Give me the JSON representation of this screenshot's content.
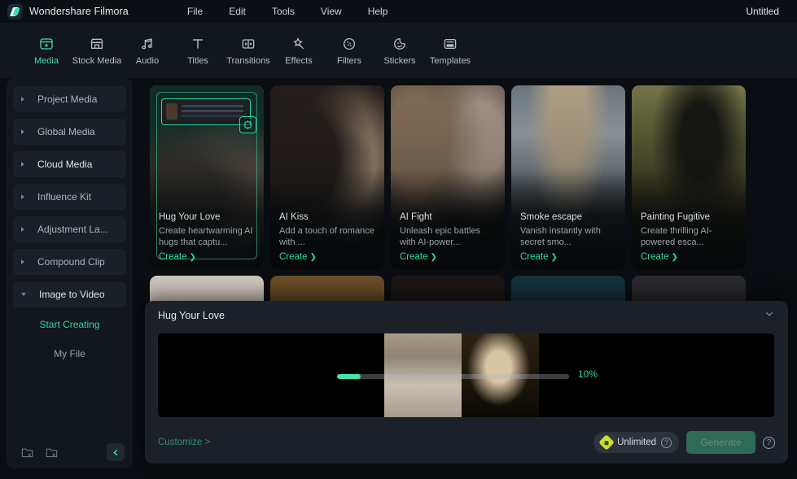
{
  "titlebar": {
    "app_name": "Wondershare Filmora",
    "project_name": "Untitled",
    "menus": [
      "File",
      "Edit",
      "Tools",
      "View",
      "Help"
    ]
  },
  "toolbar": {
    "items": [
      {
        "label": "Media",
        "icon": "media-icon",
        "active": true
      },
      {
        "label": "Stock Media",
        "icon": "stock-media-icon",
        "active": false
      },
      {
        "label": "Audio",
        "icon": "audio-icon",
        "active": false
      },
      {
        "label": "Titles",
        "icon": "titles-icon",
        "active": false
      },
      {
        "label": "Transitions",
        "icon": "transitions-icon",
        "active": false
      },
      {
        "label": "Effects",
        "icon": "effects-icon",
        "active": false
      },
      {
        "label": "Filters",
        "icon": "filters-icon",
        "active": false
      },
      {
        "label": "Stickers",
        "icon": "stickers-icon",
        "active": false
      },
      {
        "label": "Templates",
        "icon": "templates-icon",
        "active": false
      }
    ]
  },
  "sidebar": {
    "items": [
      {
        "label": "Project Media",
        "expanded": false
      },
      {
        "label": "Global Media",
        "expanded": false
      },
      {
        "label": "Cloud Media",
        "expanded": false
      },
      {
        "label": "Influence Kit",
        "expanded": false
      },
      {
        "label": "Adjustment La...",
        "expanded": false
      },
      {
        "label": "Compound Clip",
        "expanded": false
      },
      {
        "label": "Image to Video",
        "expanded": true
      }
    ],
    "sub_items": [
      {
        "label": "Start Creating",
        "active": true
      },
      {
        "label": "My File",
        "active": false
      }
    ],
    "footer": {
      "add_folder_icon": "folder-add-icon",
      "delete_folder_icon": "folder-delete-icon",
      "collapse_icon": "chevron-left-icon"
    }
  },
  "cards": [
    {
      "title": "Hug Your Love",
      "desc": "Create heartwarming AI hugs that captu...",
      "cta": "Create",
      "selected": true
    },
    {
      "title": "AI Kiss",
      "desc": "Add a touch of romance with ...",
      "cta": "Create",
      "selected": false
    },
    {
      "title": "AI Fight",
      "desc": "Unleash epic battles with AI-power...",
      "cta": "Create",
      "selected": false
    },
    {
      "title": "Smoke escape",
      "desc": "Vanish instantly with secret smo...",
      "cta": "Create",
      "selected": false
    },
    {
      "title": "Painting Fugitive",
      "desc": "Create thrilling AI-powered esca...",
      "cta": "Create",
      "selected": false
    }
  ],
  "panel": {
    "title": "Hug Your Love",
    "collapse_icon": "chevron-down-icon",
    "progress_percent": "10%",
    "progress_value": 10,
    "customize_label": "Customize >",
    "unlimited_label": "Unlimited",
    "unlimited_help": "?",
    "generate_label": "Generate",
    "generate_help": "?"
  },
  "colors": {
    "accent_green": "#2fd99a",
    "progress_green": "#45e3b1",
    "panel_bg": "#1c2129",
    "app_bg": "#0a0d11",
    "toolbar_bg": "#12161d",
    "unlimited_diamond": "#cddc2a",
    "generate_bg": "#2e6a57"
  }
}
